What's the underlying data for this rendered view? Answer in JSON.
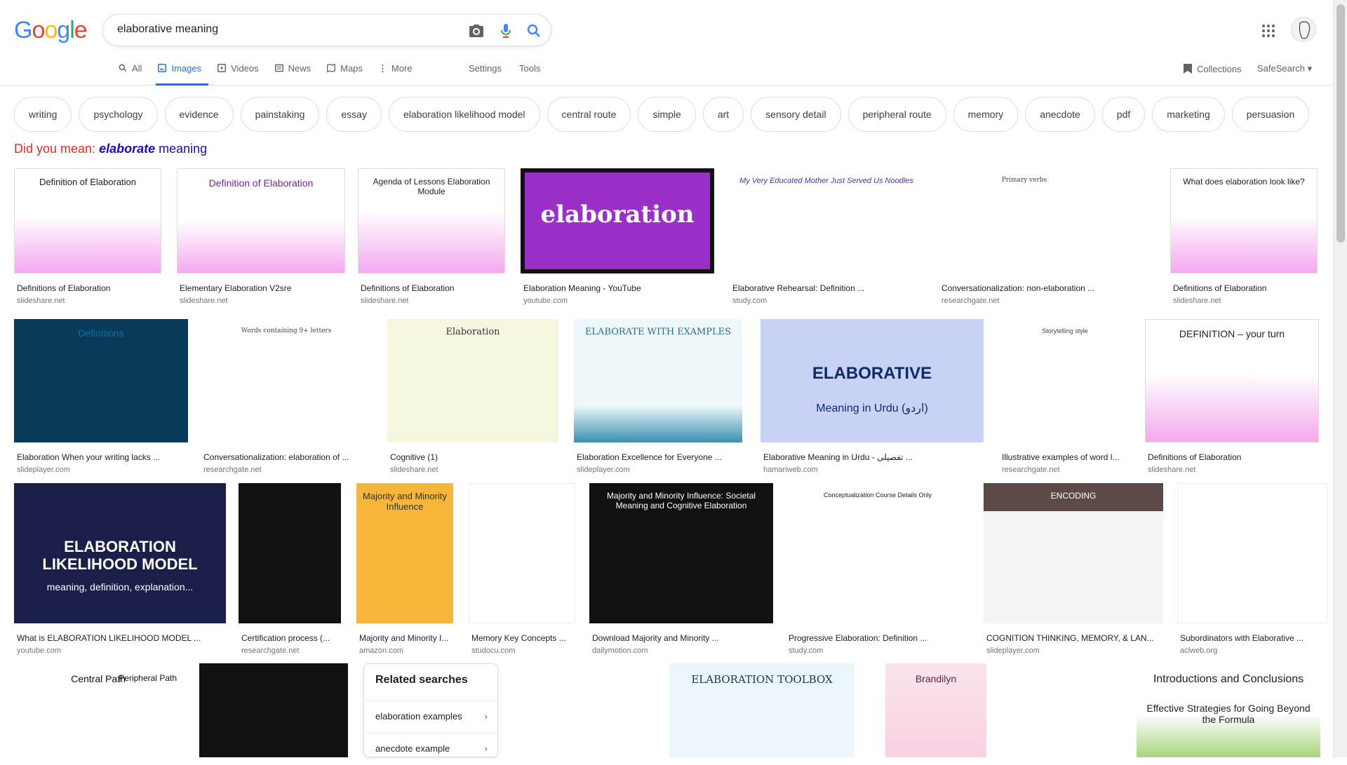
{
  "logo": "Google",
  "search": {
    "value": "elaborative meaning"
  },
  "tabs": [
    "All",
    "Images",
    "Videos",
    "News",
    "Maps",
    "More"
  ],
  "settings_label": "Settings",
  "tools_label": "Tools",
  "collections_label": "Collections",
  "safesearch_label": "SafeSearch",
  "chips": [
    "writing",
    "psychology",
    "evidence",
    "painstaking",
    "essay",
    "elaboration likelihood model",
    "central route",
    "simple",
    "art",
    "sensory detail",
    "peripheral route",
    "memory",
    "anecdote",
    "pdf",
    "marketing",
    "persuasion"
  ],
  "did_you_mean": {
    "prefix": "Did you mean:",
    "bold": "elaborate",
    "rest": "meaning"
  },
  "results": [
    {
      "title": "Definitions of Elaboration",
      "source": "slideshare.net",
      "thumb": "Definition of Elaboration"
    },
    {
      "title": "Elementary Elaboration V2sre",
      "source": "slideshare.net",
      "thumb": "Definition of Elaboration"
    },
    {
      "title": "Definitions of Elaboration",
      "source": "slideshare.net",
      "thumb": "Agenda of Lessons Elaboration Module"
    },
    {
      "title": "Elaboration Meaning - YouTube",
      "source": "youtube.com",
      "thumb": "elaboration"
    },
    {
      "title": "Elaborative Rehearsal: Definition ...",
      "source": "study.com",
      "thumb": "My Very Educated Mother Just Served Us Noodles"
    },
    {
      "title": "Conversationalization: non-elaboration ...",
      "source": "researchgate.net",
      "thumb": "Primary verbs"
    },
    {
      "title": "Definitions of Elaboration",
      "source": "slideshare.net",
      "thumb": "What does elaboration look like?"
    },
    {
      "title": "Elaboration When your writing lacks ...",
      "source": "slideplayer.com",
      "thumb": "Definitions"
    },
    {
      "title": "Conversationalization: elaboration of ...",
      "source": "researchgate.net",
      "thumb": "Words containing 9+ letters"
    },
    {
      "title": "Cognitive (1)",
      "source": "slideshare.net",
      "thumb": "Elaboration"
    },
    {
      "title": "Elaboration Excellence for Everyone ...",
      "source": "slideplayer.com",
      "thumb": "ELABORATE WITH EXAMPLES"
    },
    {
      "title": "Elaborative Meaning in Urdu - تفصیلی ...",
      "source": "hamariweb.com",
      "thumb": "ELABORATIVE",
      "thumb2": "Meaning in Urdu (اردو)"
    },
    {
      "title": "Illustrative examples of word l...",
      "source": "researchgate.net",
      "thumb": "Storytelling style"
    },
    {
      "title": "Definitions of Elaboration",
      "source": "slideshare.net",
      "thumb": "DEFINITION – your turn"
    },
    {
      "title": "What is ELABORATION LIKELIHOOD MODEL ...",
      "source": "youtube.com",
      "thumb": "ELABORATION LIKELIHOOD MODEL",
      "thumb2": "meaning, definition, explanation..."
    },
    {
      "title": "Certification process (...",
      "source": "researchgate.net",
      "thumb": ""
    },
    {
      "title": "Majority and Minority I...",
      "source": "amazon.com",
      "thumb": "Majority and Minority Influence"
    },
    {
      "title": "Memory Key Concepts ...",
      "source": "studocu.com",
      "thumb": ""
    },
    {
      "title": "Download Majority and Minority ...",
      "source": "dailymotion.com",
      "thumb": "Majority and Minority Influence: Societal Meaning and Cognitive Elaboration"
    },
    {
      "title": "Progressive Elaboration: Definition ...",
      "source": "study.com",
      "thumb": "Conceptualization Course Details Only"
    },
    {
      "title": "COGNITION THINKING, MEMORY, & LAN...",
      "source": "slideplayer.com",
      "thumb": "ENCODING"
    },
    {
      "title": "Subordinators with Elaborative ...",
      "source": "aclweb.org",
      "thumb": ""
    }
  ],
  "bottom_row": [
    {
      "thumb": "Central Path",
      "thumb2": "Peripheral Path"
    },
    {
      "thumb": ""
    },
    {
      "thumb": ""
    },
    {
      "thumb": "ELABORATION TOOLBOX"
    },
    {
      "thumb": "Brandilyn"
    },
    {
      "thumb": ""
    },
    {
      "thumb": "Introductions and Conclusions",
      "thumb2": "Effective Strategies for Going Beyond the Formula"
    }
  ],
  "related": {
    "title": "Related searches",
    "items": [
      "elaboration examples",
      "anecdote example"
    ]
  },
  "colors": {
    "accent": "#1a73e8",
    "did_you_mean": "#d93025",
    "link": "#1a0dab"
  }
}
